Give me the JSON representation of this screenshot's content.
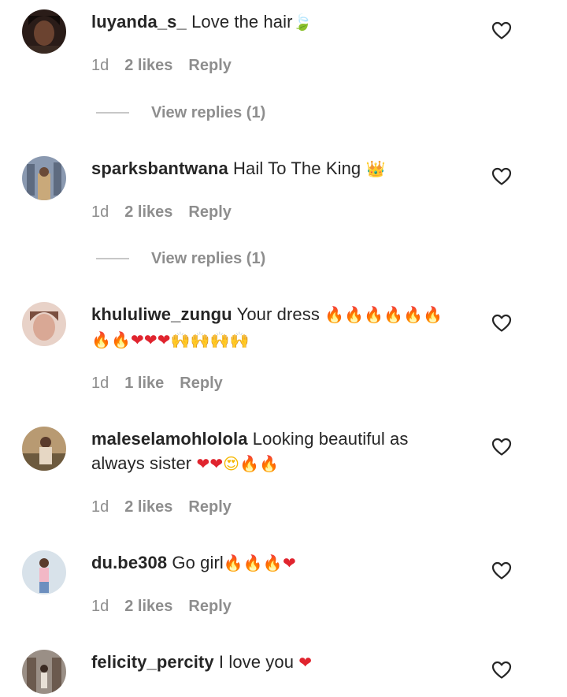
{
  "comments": [
    {
      "username": "luyanda_s_",
      "text": "Love the hair",
      "emojis": [
        {
          "char": "🍃",
          "tone": "green"
        }
      ],
      "time": "1d",
      "likes": "2 likes",
      "reply": "Reply",
      "view_replies": "View replies (1)"
    },
    {
      "username": "sparksbantwana",
      "text": "Hail To The King",
      "emojis": [
        {
          "char": "👑",
          "tone": "gold"
        }
      ],
      "time": "1d",
      "likes": "2 likes",
      "reply": "Reply",
      "view_replies": "View replies (1)"
    },
    {
      "username": "khululiwe_zungu",
      "text": "Your dress",
      "emojis": [
        {
          "char": "🔥",
          "tone": "orange"
        },
        {
          "char": "🔥",
          "tone": "orange"
        },
        {
          "char": "🔥",
          "tone": "orange"
        },
        {
          "char": "🔥",
          "tone": "orange"
        },
        {
          "char": "🔥",
          "tone": "orange"
        },
        {
          "char": "🔥",
          "tone": "orange"
        },
        {
          "char": "🔥",
          "tone": "orange"
        },
        {
          "char": "🔥",
          "tone": "orange"
        },
        {
          "char": "❤",
          "tone": "red"
        },
        {
          "char": "❤",
          "tone": "red"
        },
        {
          "char": "❤",
          "tone": "red"
        },
        {
          "char": "🙌",
          "tone": "gold"
        },
        {
          "char": "🙌",
          "tone": "gold"
        },
        {
          "char": "🙌",
          "tone": "gold"
        },
        {
          "char": "🙌",
          "tone": "gold"
        }
      ],
      "time": "1d",
      "likes": "1 like",
      "reply": "Reply"
    },
    {
      "username": "maleselamohlolola",
      "text": "Looking beautiful as always sister",
      "emojis": [
        {
          "char": "❤",
          "tone": "red"
        },
        {
          "char": "❤",
          "tone": "red"
        },
        {
          "char": "😍",
          "tone": "face"
        },
        {
          "char": "🔥",
          "tone": "orange"
        },
        {
          "char": "🔥",
          "tone": "orange"
        }
      ],
      "time": "1d",
      "likes": "2 likes",
      "reply": "Reply"
    },
    {
      "username": "du.be308",
      "text": "Go girl",
      "emojis": [
        {
          "char": "🔥",
          "tone": "orange"
        },
        {
          "char": "🔥",
          "tone": "orange"
        },
        {
          "char": "🔥",
          "tone": "orange"
        },
        {
          "char": "❤",
          "tone": "red"
        }
      ],
      "time": "1d",
      "likes": "2 likes",
      "reply": "Reply"
    },
    {
      "username": "felicity_percity",
      "text": "I love you",
      "emojis": [
        {
          "char": "❤",
          "tone": "red"
        }
      ]
    }
  ],
  "icons": {
    "like": "heart-outline-icon"
  },
  "colors": {
    "username": "#262626",
    "meta": "#8e8e8e",
    "reply_line": "#c7c7c7",
    "heart_red": "#e0242e",
    "fire": "#f2711c"
  }
}
